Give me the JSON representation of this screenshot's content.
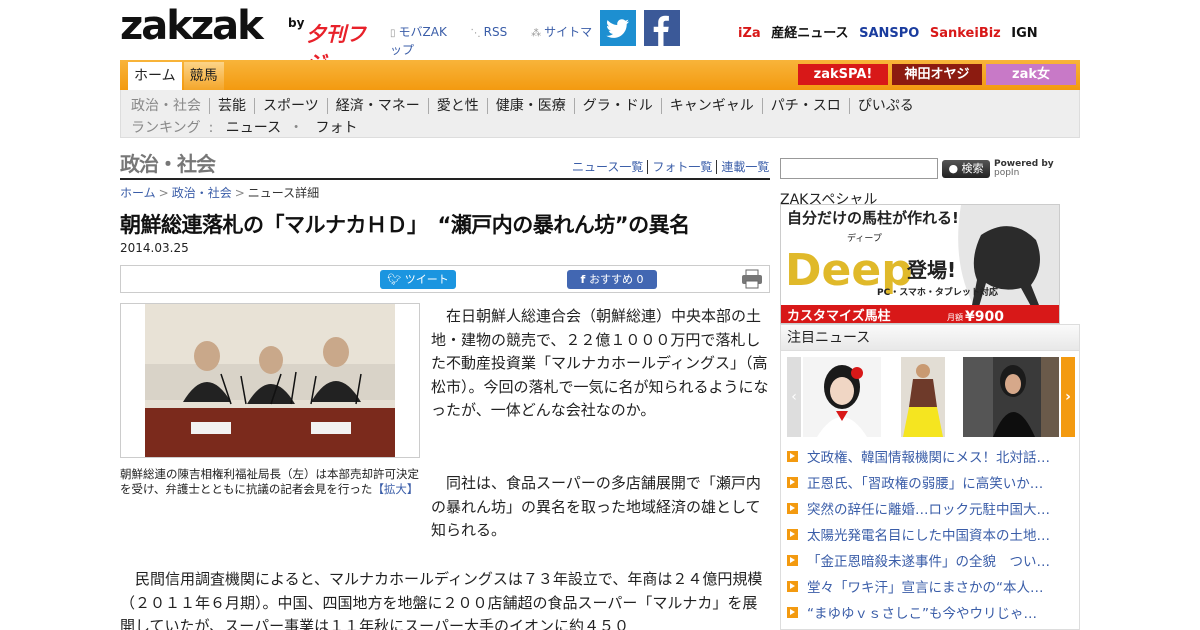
{
  "header": {
    "logo_text": "zakzak",
    "logo_by": "by",
    "logo_fuji": "夕刊フジ",
    "links": [
      "モバZAK",
      "RSS",
      "サイトマップ"
    ],
    "partners": [
      {
        "label": "iZa",
        "color": "#d81818"
      },
      {
        "label": "産経ニュース",
        "color": "#111111"
      },
      {
        "label": "SANSPO",
        "color": "#1a3c9e"
      },
      {
        "label": "SankeiBiz",
        "color": "#d81818"
      },
      {
        "label": "IGN",
        "color": "#111111"
      }
    ]
  },
  "nav": {
    "tabs": [
      {
        "label": "ホーム",
        "active": true
      },
      {
        "label": "競馬",
        "active": false
      }
    ],
    "banners": [
      "zakSPA!",
      "神田オヤジ",
      "zak女"
    ],
    "categories": [
      "政治・社会",
      "芸能",
      "スポーツ",
      "経済・マネー",
      "愛と性",
      "健康・医療",
      "グラ・ドル",
      "キャンギャル",
      "パチ・スロ",
      "ぴいぷる"
    ],
    "ranking_label": "ランキング",
    "ranking_links": [
      "ニュース",
      "フォト"
    ]
  },
  "article": {
    "section_title": "政治・社会",
    "section_links": [
      "ニュース一覧",
      "フォト一覧",
      "連載一覧"
    ],
    "breadcrumb": [
      "ホーム",
      "政治・社会",
      "ニュース詳細"
    ],
    "headline": "朝鮮総連落札の「マルナカＨＤ」　“瀬戸内の暴れん坊”の異名",
    "date": "2014.03.25",
    "tweet_label": "ツイート",
    "like_label": "おすすめ 0",
    "caption": "朝鮮総連の陳吉相権利福祉局長（左）は本部売却許可決定を受け、弁護士とともに抗議の記者会見を行った",
    "caption_expand": "【拡大】",
    "p1": "在日朝鮮人総連合会（朝鮮総連）中央本部の土地・建物の競売で、２２億１０００万円で落札した不動産投資業「マルナカホールディングス」（高松市）。今回の落札で一気に名が知られるようになったが、一体どんな会社なのか。",
    "p2": "同社は、食品スーパーの多店舗展開で「瀬戸内の暴れん坊」の異名を取った地域経済の雄として知られる。",
    "p3": "民間信用調査機関によると、マルナカホールディングスは７３年設立で、年商は２４億円規模（２０１１年６月期）。中国、四国地方を地盤に２００店舗超の食品スーパー「マルナカ」を展開していたが、スーパー事業は１１年秋にスーパー大手のイオンに約４５０"
  },
  "sidebar": {
    "search_button": "検索",
    "powered_by": "Powered by",
    "popin": "popIn",
    "zak_special": "ZAKスペシャル",
    "deep_banner": {
      "top_text": "自分だけの馬柱が作れる!",
      "furigana": "ディープ",
      "brand": "Deep",
      "tag": "登場!",
      "sub": "PC・スマホ・タブレット対応",
      "bottom_left": "カスタマイズ馬柱",
      "price_prefix": "月額",
      "price": "¥900"
    },
    "attention_title": "注目ニュース",
    "news": [
      "文政権、韓国情報機関にメス！北対話…",
      "正恩氏、「習政権の弱腰」に高笑いか…",
      "突然の辞任に離婚…ロック元駐中国大…",
      "太陽光発電名目にした中国資本の土地…",
      "「金正恩暗殺未遂事件」の全貌　つい…",
      "堂々「ワキ汗」宣言にまさかの“本人…",
      "“まゆゆｖｓさしこ”も今やウリじゃ…"
    ]
  }
}
